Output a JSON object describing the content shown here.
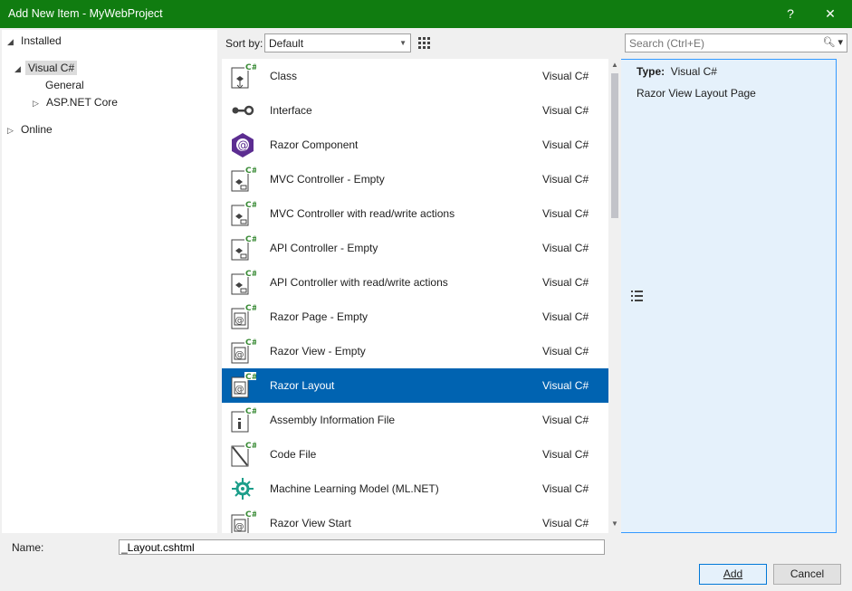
{
  "window": {
    "title": "Add New Item - MyWebProject",
    "help_label": "?",
    "close_label": "✕"
  },
  "tree": {
    "installed": "Installed",
    "visual_csharp": "Visual C#",
    "general": "General",
    "aspnet_core": "ASP.NET Core",
    "online": "Online"
  },
  "toolbar": {
    "sort_label": "Sort by:",
    "sort_value": "Default",
    "search_placeholder": "Search (Ctrl+E)"
  },
  "templates": [
    {
      "name": "Class",
      "lang": "Visual C#",
      "icon": "class-template-icon"
    },
    {
      "name": "Interface",
      "lang": "Visual C#",
      "icon": "interface-template-icon"
    },
    {
      "name": "Razor Component",
      "lang": "Visual C#",
      "icon": "razor-component-icon"
    },
    {
      "name": "MVC Controller - Empty",
      "lang": "Visual C#",
      "icon": "controller-template-icon"
    },
    {
      "name": "MVC Controller with read/write actions",
      "lang": "Visual C#",
      "icon": "controller-template-icon"
    },
    {
      "name": "API Controller - Empty",
      "lang": "Visual C#",
      "icon": "controller-template-icon"
    },
    {
      "name": "API Controller with read/write actions",
      "lang": "Visual C#",
      "icon": "controller-template-icon"
    },
    {
      "name": "Razor Page - Empty",
      "lang": "Visual C#",
      "icon": "razor-page-icon"
    },
    {
      "name": "Razor View - Empty",
      "lang": "Visual C#",
      "icon": "razor-page-icon"
    },
    {
      "name": "Razor Layout",
      "lang": "Visual C#",
      "icon": "razor-page-icon",
      "selected": true
    },
    {
      "name": "Assembly Information File",
      "lang": "Visual C#",
      "icon": "info-file-icon"
    },
    {
      "name": "Code File",
      "lang": "Visual C#",
      "icon": "code-file-icon"
    },
    {
      "name": "Machine Learning Model (ML.NET)",
      "lang": "Visual C#",
      "icon": "ml-model-icon"
    },
    {
      "name": "Razor View Start",
      "lang": "Visual C#",
      "icon": "razor-page-icon"
    }
  ],
  "details": {
    "type_label": "Type:",
    "type_value": "Visual C#",
    "description": "Razor View Layout Page"
  },
  "bottom": {
    "name_label": "Name:",
    "name_value": "_Layout.cshtml",
    "add_label": "Add",
    "cancel_label": "Cancel"
  },
  "colors": {
    "titlebar": "#107c10",
    "selection": "#0063b1",
    "razor_purple": "#5c2d91",
    "csharp_green": "#388a34"
  }
}
